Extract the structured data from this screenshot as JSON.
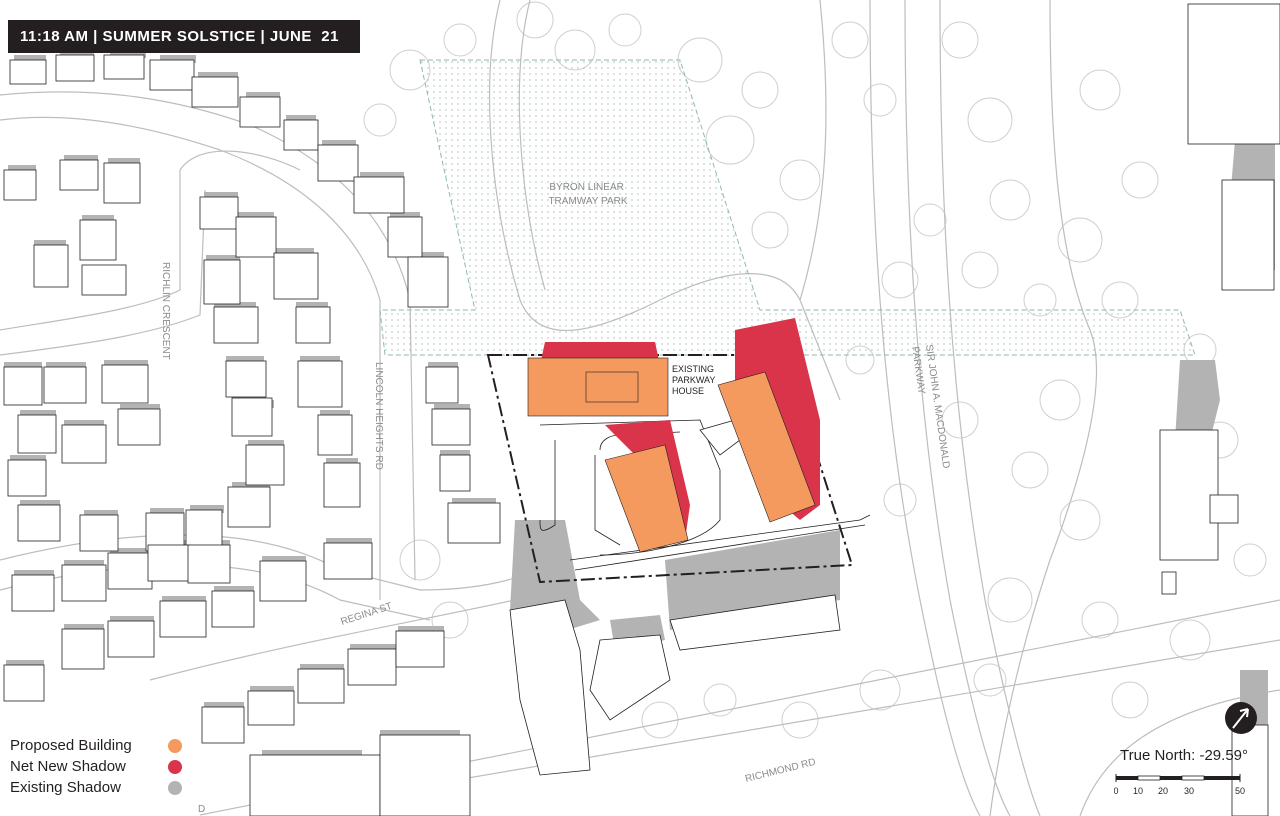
{
  "header": {
    "title": "11:18 AM | SUMMER SOLSTICE | JUNE  21"
  },
  "legend": {
    "items": [
      {
        "label": "Proposed Building",
        "color": "#f59a5e"
      },
      {
        "label": "Net New Shadow",
        "color": "#d9344a"
      },
      {
        "label": "Existing Shadow",
        "color": "#b3b3b3"
      }
    ]
  },
  "map": {
    "park_label_line1": "BYRON LINEAR",
    "park_label_line2": "TRAMWAY PARK",
    "house_label_line1": "EXISTING",
    "house_label_line2": "PARKWAY",
    "house_label_line3": "HOUSE",
    "street_richlin": "RICHLIN CRESCENT",
    "street_lincoln": "LINCOLN HEIGHTS RD",
    "street_regina": "REGINA ST",
    "street_richmond": "RICHMOND RD",
    "street_parkway_line1": "SIR JOHN A. MACDONALD",
    "street_parkway_line2": "PARKWAY",
    "street_partial": "D"
  },
  "north_arrow": {
    "icon": "north-arrow-icon",
    "label": "True North: -29.59°"
  },
  "scale_bar": {
    "ticks": [
      "0",
      "10",
      "20",
      "30",
      "50"
    ]
  }
}
